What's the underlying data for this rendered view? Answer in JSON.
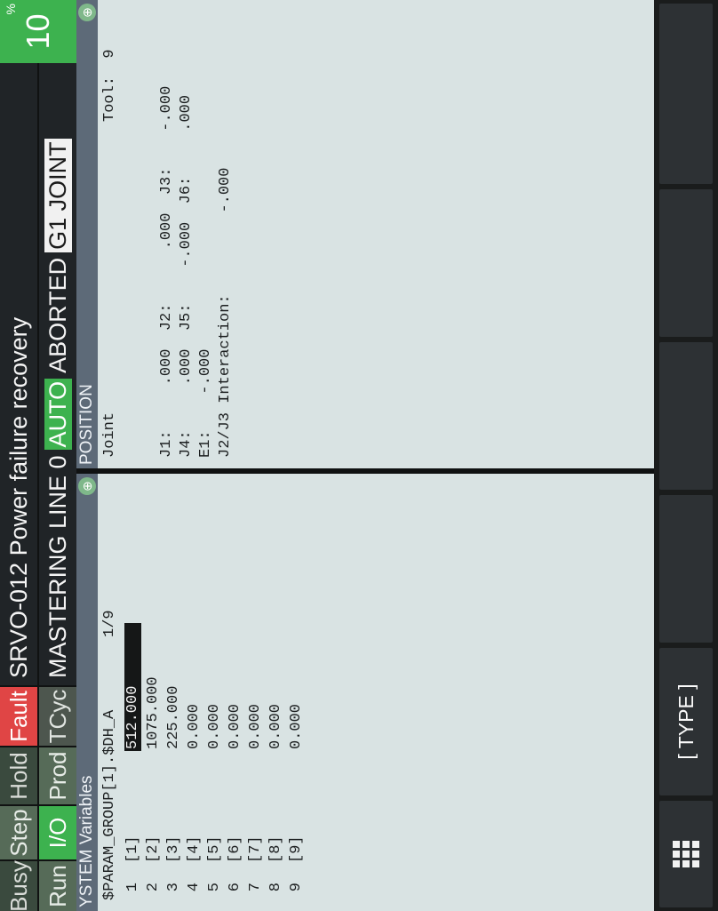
{
  "status_row1": [
    {
      "label": "Busy",
      "state": "off"
    },
    {
      "label": "Step",
      "state": "dim"
    },
    {
      "label": "Hold",
      "state": "off"
    },
    {
      "label": "Fault",
      "state": "fault"
    }
  ],
  "status_row2": [
    {
      "label": "Run",
      "state": "dim"
    },
    {
      "label": "I/O",
      "state": "on"
    },
    {
      "label": "Prod",
      "state": "dim"
    },
    {
      "label": "TCyc",
      "state": "gray"
    }
  ],
  "alarm": "SRVO-012 Power failure recovery",
  "mode": {
    "prefix": "MASTERING LINE 0",
    "auto": "AUTO",
    "aborted": "ABORTED",
    "group": "G1 JOINT"
  },
  "override": {
    "value": "10",
    "unit": "%"
  },
  "left_pane": {
    "title": "YSTEM Variables",
    "variable_name": "$PARAM_GROUP[1].$DH_A",
    "page": "1/9",
    "rows": [
      {
        "n": "1",
        "key": "[1]",
        "value": "512.000"
      },
      {
        "n": "2",
        "key": "[2]",
        "value": "1075.000"
      },
      {
        "n": "3",
        "key": "[3]",
        "value": "225.000"
      },
      {
        "n": "4",
        "key": "[4]",
        "value": "0.000"
      },
      {
        "n": "5",
        "key": "[5]",
        "value": "0.000"
      },
      {
        "n": "6",
        "key": "[6]",
        "value": "0.000"
      },
      {
        "n": "7",
        "key": "[7]",
        "value": "0.000"
      },
      {
        "n": "8",
        "key": "[8]",
        "value": "0.000"
      },
      {
        "n": "9",
        "key": "[9]",
        "value": "0.000"
      }
    ]
  },
  "right_pane": {
    "title": "POSITION",
    "mode_label": "Joint",
    "tool_label": "Tool:  9",
    "line1": "J1:     .000  J2:      .000  J3:    -.000",
    "line2": "J4:     .000  J5:    -.000  J6:     .000",
    "line3": "E1:    -.000",
    "line4": "J2/J3 Interaction:         -.000"
  },
  "function_keys": {
    "type_label": "[ TYPE ]"
  },
  "colors": {
    "green": "#3db24f",
    "fault": "#e04545",
    "title_bar": "#5d6a78",
    "pane_bg": "#d9e3e3"
  }
}
